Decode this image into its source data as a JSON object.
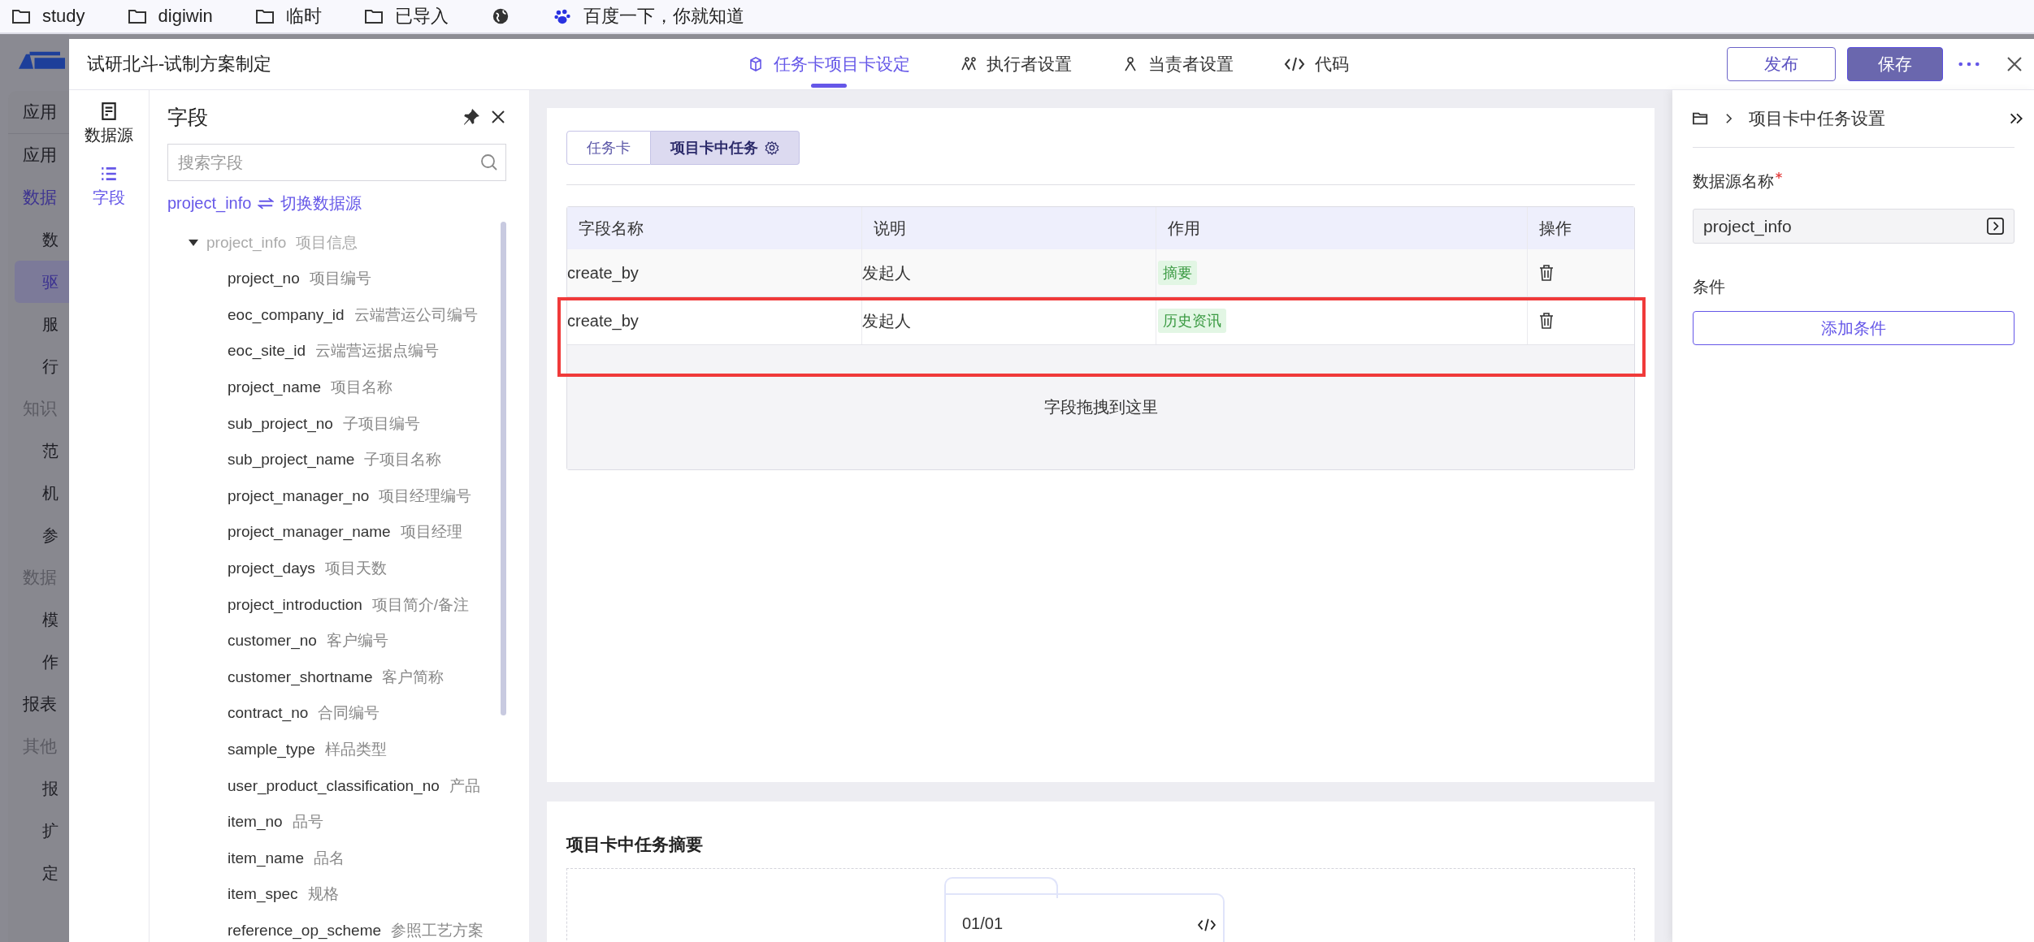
{
  "bookmarks": [
    {
      "kind": "folder",
      "label": "study"
    },
    {
      "kind": "folder",
      "label": "digiwin"
    },
    {
      "kind": "folder",
      "label": "临时"
    },
    {
      "kind": "folder",
      "label": "已导入"
    },
    {
      "kind": "globe"
    },
    {
      "kind": "paw",
      "label": "百度一下，你就知道"
    }
  ],
  "background_nav": [
    {
      "kind": "top",
      "label": "应用",
      "selected": false
    },
    {
      "kind": "link",
      "label": "应用",
      "selected": false
    },
    {
      "kind": "link",
      "label": "数据",
      "selected": true
    },
    {
      "kind": "sub",
      "label": "数",
      "selected": false
    },
    {
      "kind": "sub",
      "label": "驱",
      "selected": true
    },
    {
      "kind": "sub",
      "label": "服",
      "selected": false
    },
    {
      "kind": "sub",
      "label": "行",
      "selected": false
    },
    {
      "kind": "section",
      "label": "知识",
      "selected": false
    },
    {
      "kind": "sub",
      "label": "范",
      "selected": false
    },
    {
      "kind": "sub",
      "label": "机",
      "selected": false
    },
    {
      "kind": "sub",
      "label": "参",
      "selected": false
    },
    {
      "kind": "section",
      "label": "数据",
      "selected": false
    },
    {
      "kind": "sub",
      "label": "模",
      "selected": false
    },
    {
      "kind": "sub",
      "label": "作",
      "selected": false
    },
    {
      "kind": "link",
      "label": "报表",
      "selected": false
    },
    {
      "kind": "section",
      "label": "其他",
      "selected": false
    },
    {
      "kind": "sub",
      "label": "报",
      "selected": false
    },
    {
      "kind": "sub",
      "label": "扩",
      "selected": false
    },
    {
      "kind": "sub",
      "label": "定",
      "selected": false
    }
  ],
  "window": {
    "title": "试研北斗-试制方案制定"
  },
  "tabs": [
    {
      "kind": "cube",
      "label": "任务卡项目卡设定",
      "selected": true
    },
    {
      "kind": "people",
      "label": "执行者设置",
      "selected": false
    },
    {
      "kind": "person",
      "label": "当责者设置",
      "selected": false
    },
    {
      "kind": "code",
      "label": "代码",
      "selected": false
    }
  ],
  "actions": {
    "publish": "发布",
    "save": "保存"
  },
  "side_tabs": [
    {
      "kind": "datasource",
      "label": "数据源",
      "selected": false
    },
    {
      "kind": "list",
      "label": "字段",
      "selected": true
    }
  ],
  "fields_panel": {
    "title": "字段",
    "search": {
      "placeholder": "搜索字段"
    },
    "source": "project_info",
    "switch_link": "切换数据源",
    "tree": {
      "name": "project_info",
      "desc": "项目信息",
      "expanded": true,
      "children": [
        {
          "name": "project_no",
          "desc": "项目编号"
        },
        {
          "name": "eoc_company_id",
          "desc": "云端营运公司编号"
        },
        {
          "name": "eoc_site_id",
          "desc": "云端营运据点编号"
        },
        {
          "name": "project_name",
          "desc": "项目名称"
        },
        {
          "name": "sub_project_no",
          "desc": "子项目编号"
        },
        {
          "name": "sub_project_name",
          "desc": "子项目名称"
        },
        {
          "name": "project_manager_no",
          "desc": "项目经理编号"
        },
        {
          "name": "project_manager_name",
          "desc": "项目经理"
        },
        {
          "name": "project_days",
          "desc": "项目天数"
        },
        {
          "name": "project_introduction",
          "desc": "项目简介/备注"
        },
        {
          "name": "customer_no",
          "desc": "客户编号"
        },
        {
          "name": "customer_shortname",
          "desc": "客户简称"
        },
        {
          "name": "contract_no",
          "desc": "合同编号"
        },
        {
          "name": "sample_type",
          "desc": "样品类型"
        },
        {
          "name": "user_product_classification_no",
          "desc": "产品"
        },
        {
          "name": "item_no",
          "desc": "品号"
        },
        {
          "name": "item_name",
          "desc": "品名"
        },
        {
          "name": "item_spec",
          "desc": "规格"
        },
        {
          "name": "reference_op_scheme",
          "desc": "参照工艺方案"
        }
      ]
    }
  },
  "card_tabs": [
    {
      "label": "任务卡",
      "selected": false
    },
    {
      "label": "项目卡中任务",
      "selected": true
    }
  ],
  "table": {
    "columns": [
      "字段名称",
      "说明",
      "作用",
      "操作"
    ],
    "rows": [
      {
        "field": "create_by",
        "desc": "发起人",
        "role": "摘要",
        "highlighted": false
      },
      {
        "field": "create_by",
        "desc": "发起人",
        "role": "历史资讯",
        "highlighted": true
      }
    ],
    "drop_hint": "字段拖拽到这里"
  },
  "summary": {
    "title": "项目卡中任务摘要",
    "page": "01/01"
  },
  "settings": {
    "breadcrumb": "项目卡中任务设置",
    "source_label": "数据源名称",
    "required": true,
    "source_value": "project_info",
    "conditions_label": "条件",
    "add_button": "添加条件"
  }
}
